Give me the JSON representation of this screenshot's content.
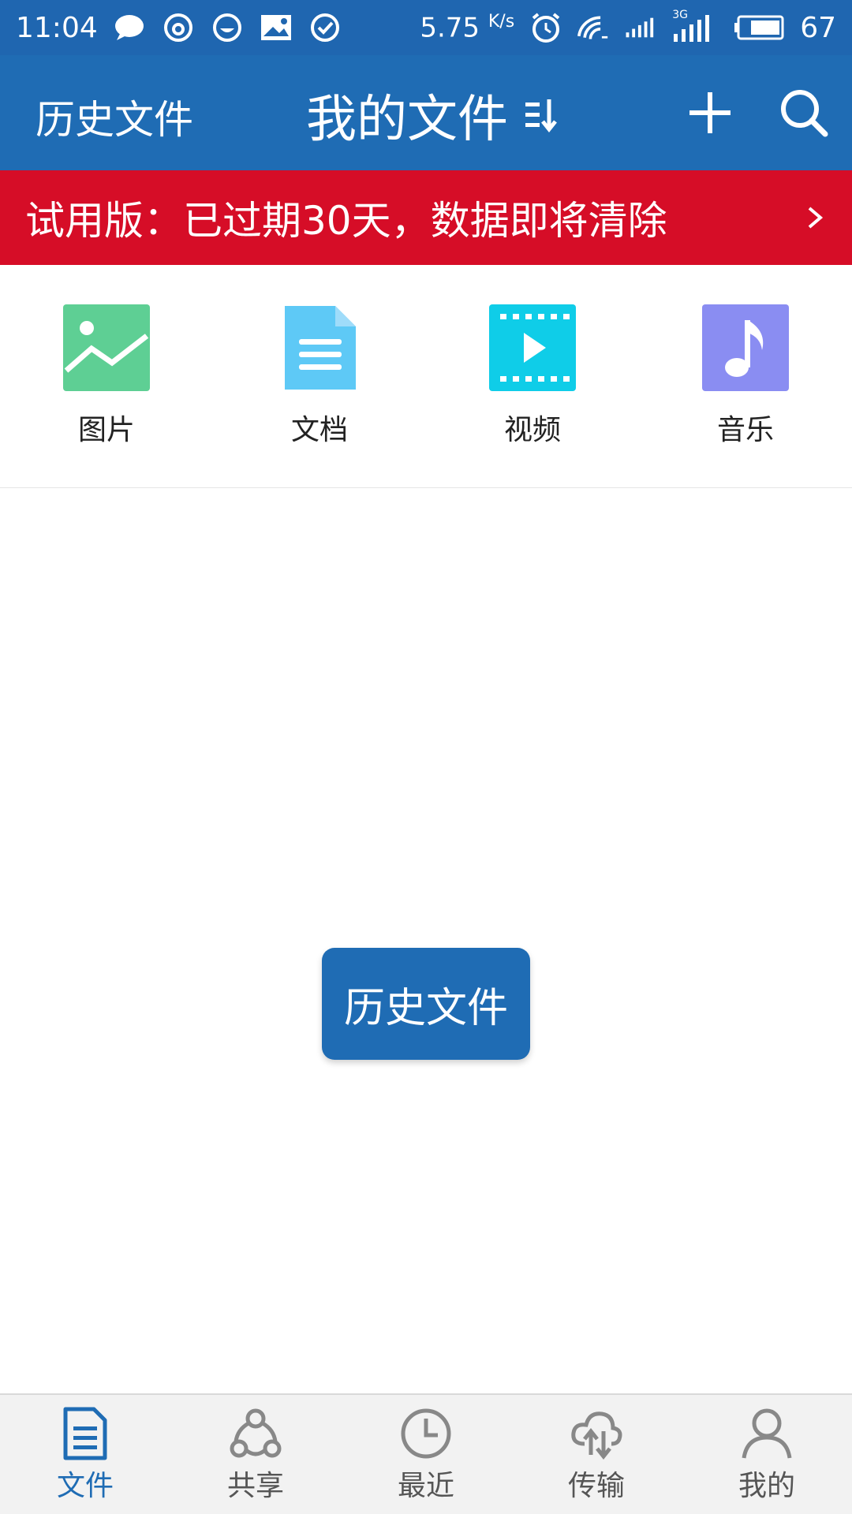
{
  "status_bar": {
    "time": "11:04",
    "speed_value": "5.75",
    "speed_unit": "K/s",
    "battery": "67",
    "network": "3G",
    "icons": [
      "message-icon",
      "weibo-icon",
      "face-icon",
      "image-icon",
      "check-icon",
      "alarm-icon",
      "wifi-icon",
      "signal-icon",
      "signal-3g-icon",
      "battery-icon"
    ]
  },
  "header": {
    "history_label": "历史文件",
    "title": "我的文件",
    "icons": [
      "sort-icon",
      "add-icon",
      "search-icon"
    ]
  },
  "banner": {
    "text": "试用版：已过期30天，数据即将清除",
    "icon": "chevron-right-icon"
  },
  "categories": [
    {
      "label": "图片",
      "icon": "picture-icon",
      "color": "#5ecf94"
    },
    {
      "label": "文档",
      "icon": "document-icon",
      "color": "#5ec9f6"
    },
    {
      "label": "视频",
      "icon": "video-icon",
      "color": "#0fcde8"
    },
    {
      "label": "音乐",
      "icon": "music-icon",
      "color": "#8a8df2"
    }
  ],
  "center_button": {
    "label": "历史文件"
  },
  "bottom_nav": [
    {
      "label": "文件",
      "icon": "file-icon",
      "active": true
    },
    {
      "label": "共享",
      "icon": "share-icon",
      "active": false
    },
    {
      "label": "最近",
      "icon": "clock-icon",
      "active": false
    },
    {
      "label": "传输",
      "icon": "cloud-transfer-icon",
      "active": false
    },
    {
      "label": "我的",
      "icon": "profile-icon",
      "active": false
    }
  ],
  "colors": {
    "primary": "#1f6cb4",
    "banner": "#d60d27",
    "nav_bg": "#f2f2f2"
  }
}
